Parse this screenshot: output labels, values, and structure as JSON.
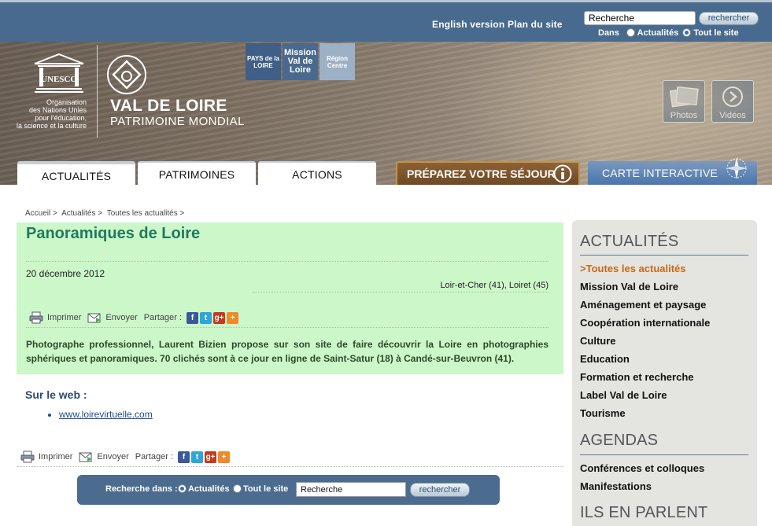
{
  "header": {
    "english_link": "English version",
    "sitemap_link": "Plan du site",
    "search_value": "Recherche",
    "search_button": "rechercher",
    "dans_label": "Dans",
    "option_actualites": "Actualités",
    "option_site": "Tout le site"
  },
  "banner": {
    "unesco_wordmark": "UNESCO",
    "unesco_caption": [
      "Organisation",
      "des Nations Unies",
      "pour l'éducation,",
      "la science et la culture"
    ],
    "site_title": "VAL DE LOIRE",
    "site_subtitle": "PATRIMOINE MONDIAL",
    "partners": [
      {
        "label": "PAYS de la LOIRE"
      },
      {
        "label": "Mission Val de Loire"
      },
      {
        "label": "Région Centre"
      }
    ],
    "media_photos": "Photos",
    "media_videos": "Vidéos"
  },
  "nav": {
    "tab_actualites": "ACTUALITÉS",
    "tab_patrimoines": "PATRIMOINES",
    "tab_actions": "ACTIONS",
    "tab_sejour": "PRÉPAREZ VOTRE SÉJOUR",
    "tab_carte": "CARTE INTERACTIVE"
  },
  "breadcrumb": [
    "Accueil >",
    "Actualités >",
    "Toutes les actualités >"
  ],
  "article": {
    "title": "Panoramiques de Loire",
    "date": "20 décembre 2012",
    "places": "Loir-et-Cher (41), Loiret (45)",
    "print": "Imprimer",
    "send": "Envoyer",
    "share": "Partager :",
    "body": "Photographe professionnel, Laurent Bizien propose sur son site de faire découvrir la Loire en photographies sphériques et panoramiques. 70 clichés sont à ce jour en ligne de Saint-Satur (18) à Candé-sur-Beuvron (41)."
  },
  "web": {
    "title": "Sur le web :",
    "link": "www.loirevirtuelle.com"
  },
  "bottom_search": {
    "label": "Recherche dans :",
    "option_actualites": "Actualités",
    "option_site": "Tout le site",
    "value": "Recherche",
    "button": "rechercher"
  },
  "sidebar": {
    "heading_actualites": "ACTUALITÉS",
    "items": [
      ">Toutes les actualités",
      "Mission Val de Loire",
      "Aménagement et paysage",
      "Coopération internationale",
      "Culture",
      "Education",
      "Formation et recherche",
      "Label Val de Loire",
      "Tourisme"
    ],
    "heading_agendas": "AGENDAS",
    "agenda_items": [
      "Conférences et colloques",
      "Manifestations"
    ],
    "heading_ils": "ILS EN PARLENT"
  },
  "colors": {
    "header_blue": "#476a8e",
    "article_green": "#ccf7c9",
    "title_green": "#1f7a5e",
    "active_orange": "#c36a16"
  }
}
